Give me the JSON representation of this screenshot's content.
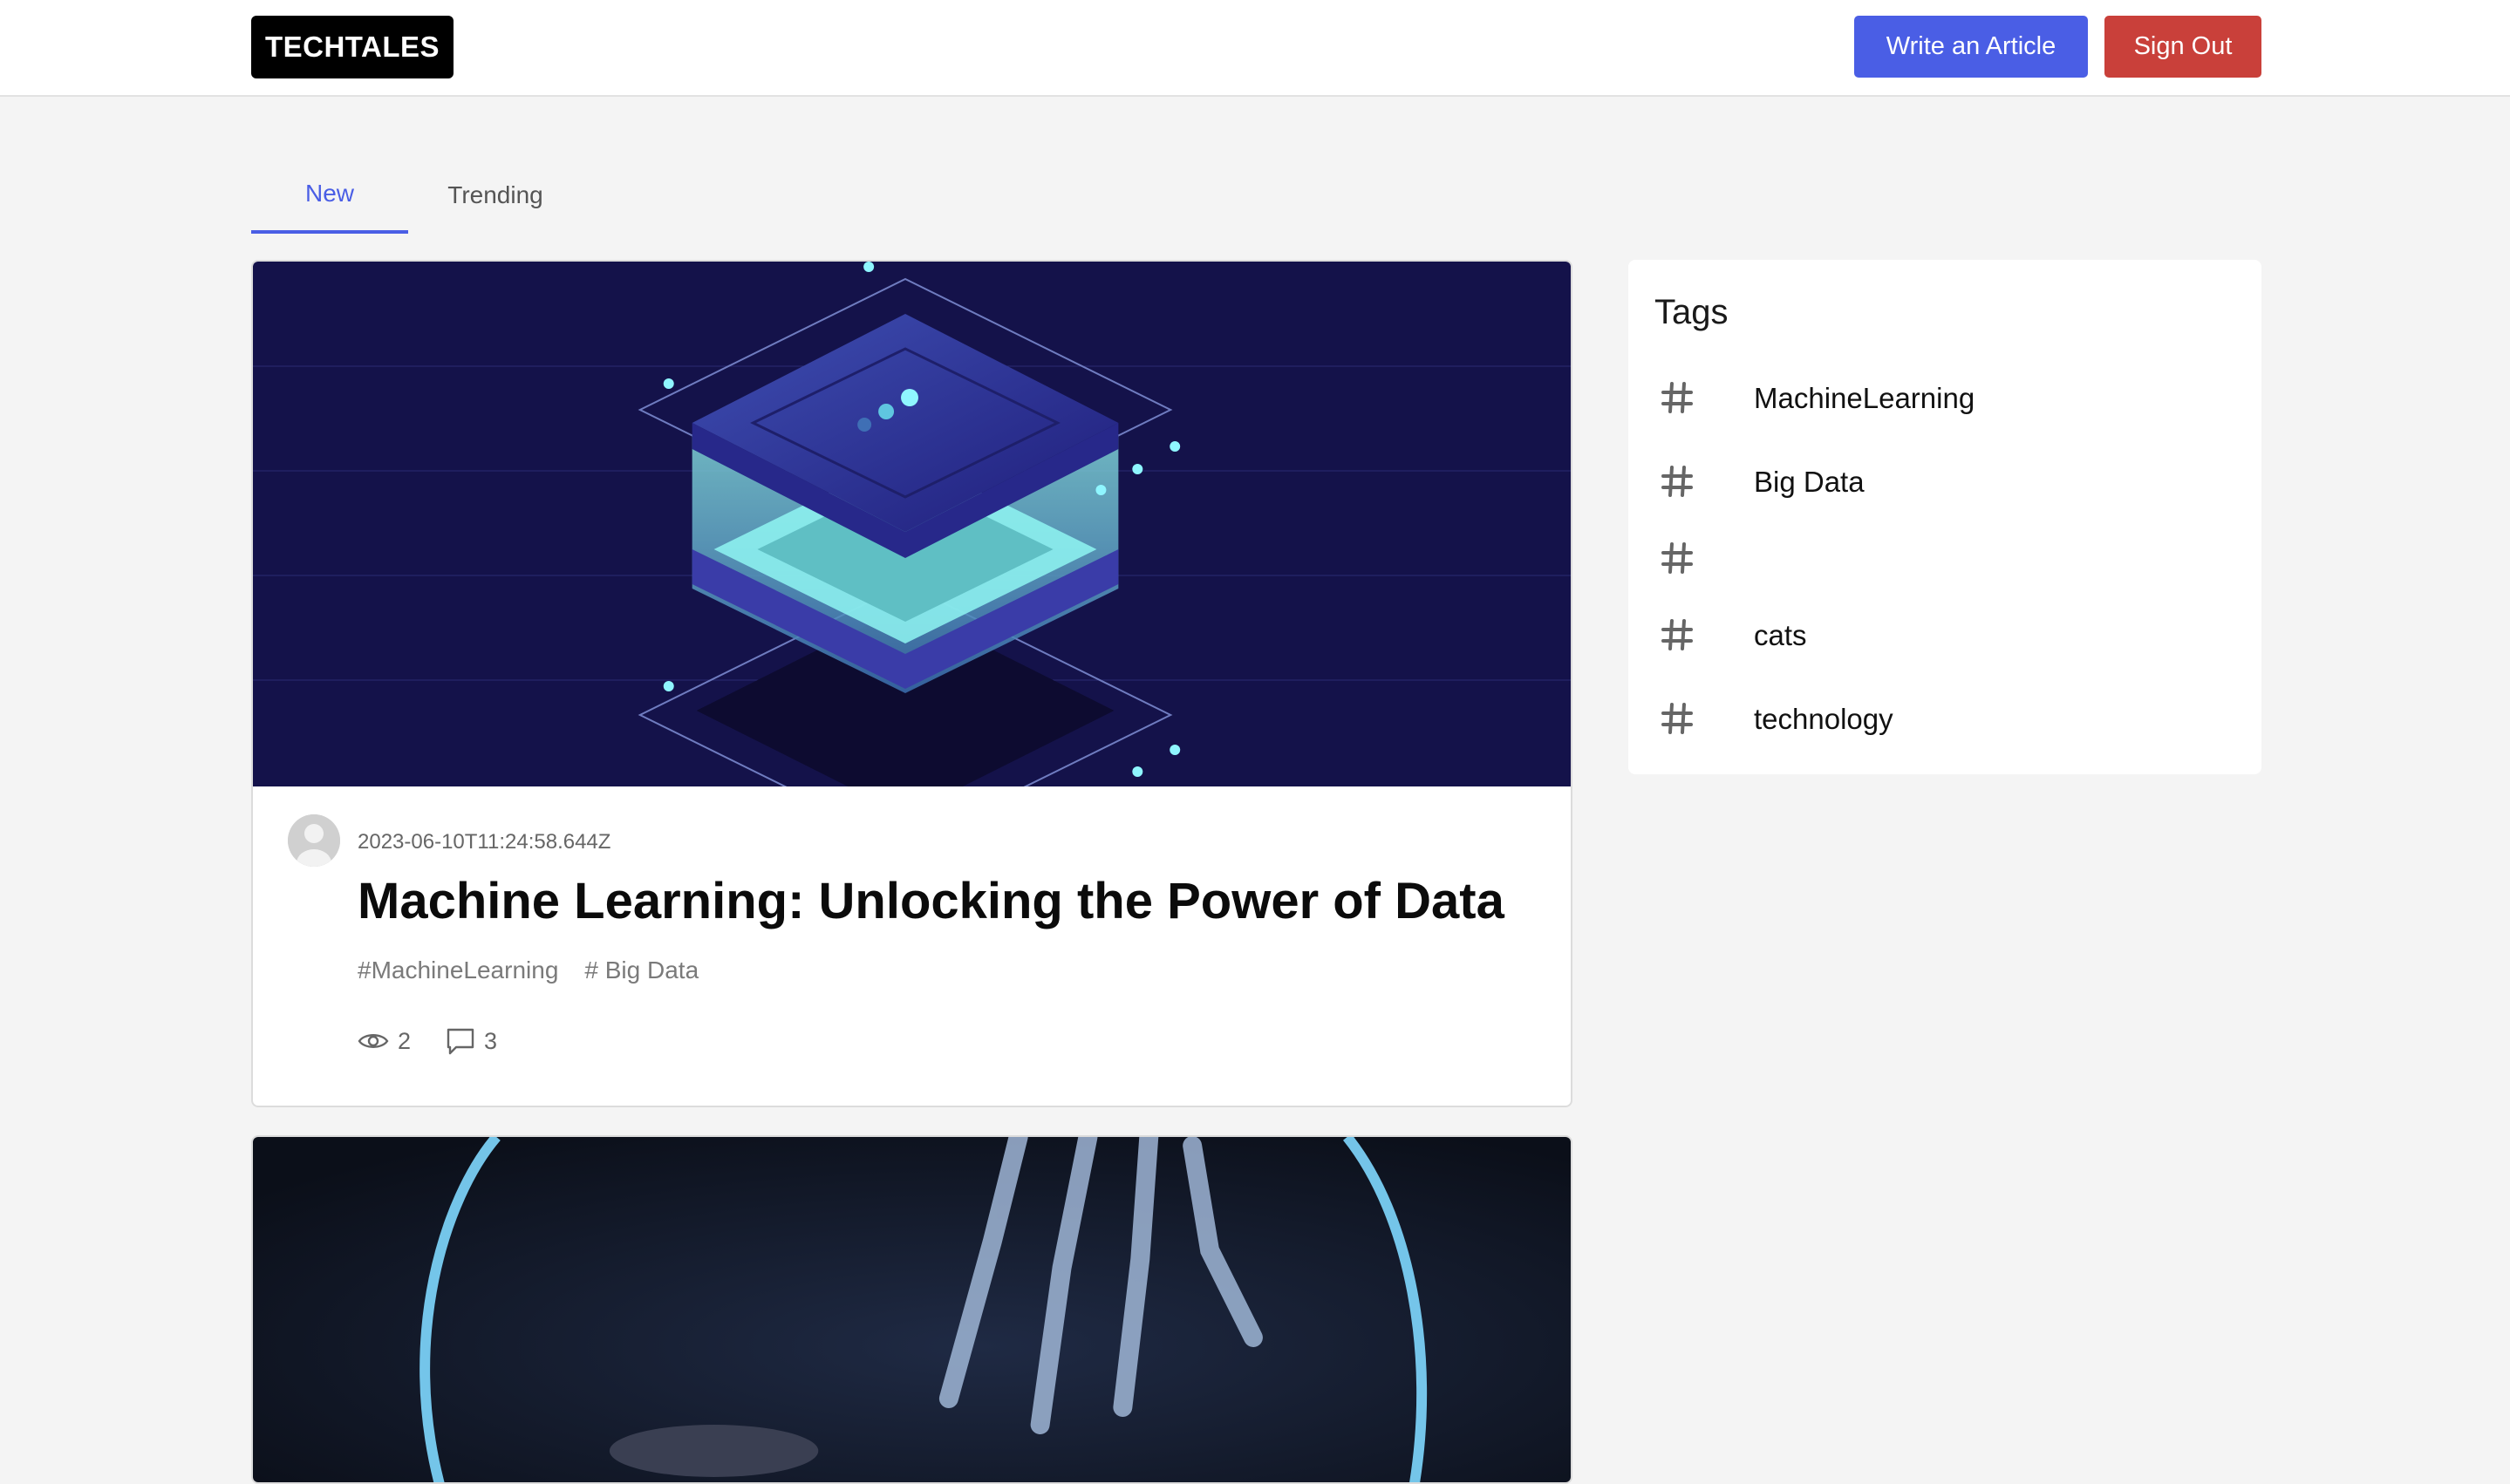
{
  "header": {
    "logo": "TECHTALES",
    "write_button": "Write an Article",
    "signout_button": "Sign Out"
  },
  "tabs": [
    {
      "label": "New",
      "active": true
    },
    {
      "label": "Trending",
      "active": false
    }
  ],
  "articles": [
    {
      "date": "2023-06-10T11:24:58.644Z",
      "title": "Machine Learning: Unlocking the Power of Data",
      "tags": [
        "#MachineLearning",
        "# Big Data"
      ],
      "views": "2",
      "comments": "3"
    }
  ],
  "sidebar": {
    "title": "Tags",
    "tags": [
      "MachineLearning",
      "Big Data",
      "",
      "cats",
      "technology"
    ]
  },
  "colors": {
    "accent": "#4a5ee5",
    "danger": "#c9403a",
    "background": "#f4f4f4"
  }
}
